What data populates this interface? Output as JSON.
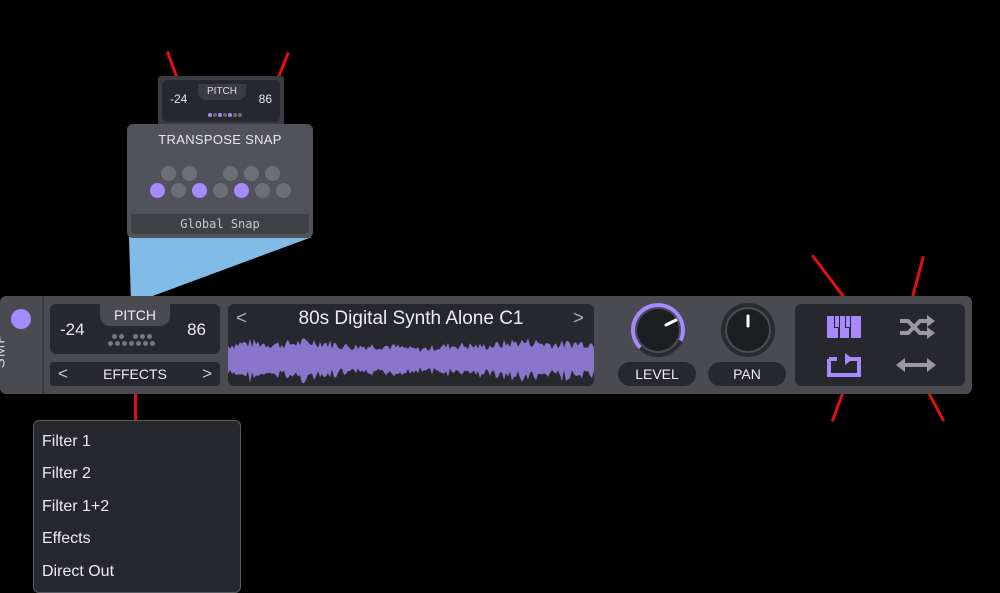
{
  "mini_pitch": {
    "label": "PITCH",
    "low": "-24",
    "high": "86"
  },
  "transpose_snap": {
    "title": "TRANSPOSE SNAP",
    "footer": "Global Snap",
    "active_keys": [
      "C",
      "E",
      "G"
    ]
  },
  "strip": {
    "side_label": "SMP",
    "enabled": true,
    "pitch": {
      "label": "PITCH",
      "low": "-24",
      "high": "86"
    },
    "effects": {
      "label": "EFFECTS",
      "prev": "<",
      "next": ">"
    },
    "sample": {
      "name": "80s Digital Synth Alone C1",
      "prev": "<",
      "next": ">"
    },
    "knobs": [
      {
        "label": "LEVEL",
        "value": 0.82
      },
      {
        "label": "PAN",
        "value": 0.5
      }
    ],
    "icons": [
      {
        "name": "keytrack-icon",
        "active": true
      },
      {
        "name": "random-phase-icon",
        "active": false
      },
      {
        "name": "loop-icon",
        "active": true
      },
      {
        "name": "bounce-icon",
        "active": false
      }
    ]
  },
  "dropdown": {
    "items": [
      "Filter 1",
      "Filter 2",
      "Filter 1+2",
      "Effects",
      "Direct Out"
    ]
  },
  "colors": {
    "accent": "#a688ff",
    "panel": "#4a4b51",
    "inset": "#27282d",
    "annotation": "#e01010"
  }
}
